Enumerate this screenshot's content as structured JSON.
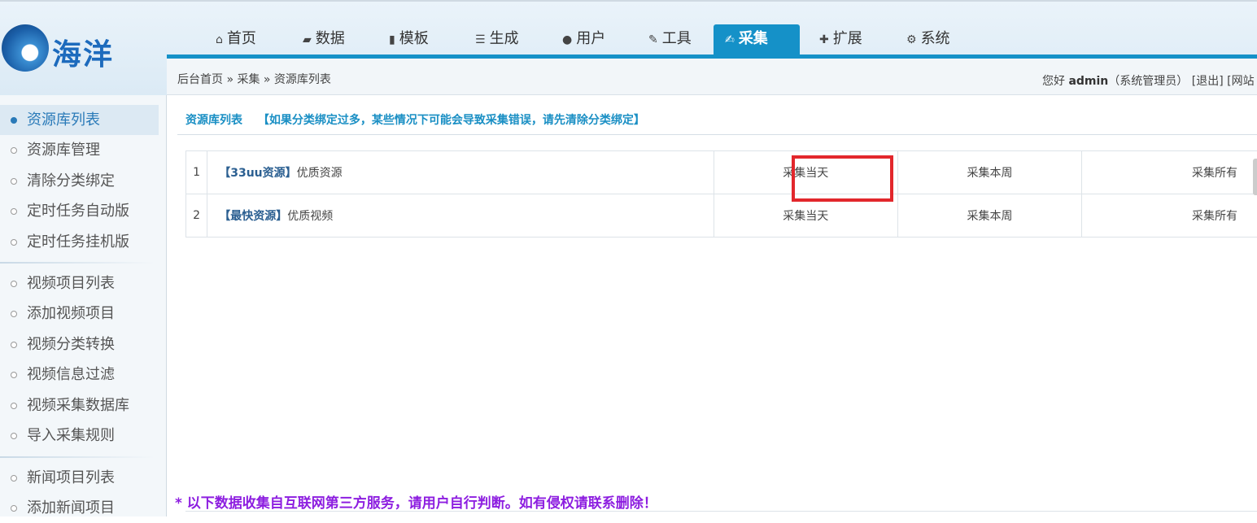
{
  "logo": {
    "text": "海洋"
  },
  "nav": [
    {
      "label": "首页",
      "icon": "home-icon",
      "glyph": "⌂"
    },
    {
      "label": "数据",
      "icon": "book-icon",
      "glyph": "▰"
    },
    {
      "label": "模板",
      "icon": "file-icon",
      "glyph": "▮"
    },
    {
      "label": "生成",
      "icon": "server-icon",
      "glyph": "☰"
    },
    {
      "label": "用户",
      "icon": "user-icon",
      "glyph": "●"
    },
    {
      "label": "工具",
      "icon": "wrench-icon",
      "glyph": "✎"
    },
    {
      "label": "采集",
      "icon": "edit-icon",
      "glyph": "✍",
      "active": true
    },
    {
      "label": "扩展",
      "icon": "puzzle-icon",
      "glyph": "✚"
    },
    {
      "label": "系统",
      "icon": "gear-icon",
      "glyph": "⚙"
    }
  ],
  "breadcrumb": "后台首页 » 采集 » 资源库列表",
  "user": {
    "greeting": "您好",
    "name": "admin",
    "role": "（系统管理员）",
    "logout": "[退出]",
    "site": "[网站"
  },
  "sidebar": [
    {
      "label": "资源库列表",
      "active": true
    },
    {
      "label": "资源库管理"
    },
    {
      "label": "清除分类绑定"
    },
    {
      "label": "定时任务自动版"
    },
    {
      "label": "定时任务挂机版"
    },
    {
      "label": "视频项目列表"
    },
    {
      "label": "添加视频项目"
    },
    {
      "label": "视频分类转换"
    },
    {
      "label": "视频信息过滤"
    },
    {
      "label": "视频采集数据库"
    },
    {
      "label": "导入采集规则"
    },
    {
      "label": "新闻项目列表"
    },
    {
      "label": "添加新闻项目"
    }
  ],
  "content": {
    "title": "资源库列表",
    "warning": "【如果分类绑定过多，某些情况下可能会导致采集错误，请先清除分类绑定】"
  },
  "resources": [
    {
      "num": "1",
      "name": "【33uu资源】",
      "desc": "优质资源",
      "today": "采集当天",
      "week": "采集本周",
      "all": "采集所有"
    },
    {
      "num": "2",
      "name": "【最快资源】",
      "desc": "优质视频",
      "today": "采集当天",
      "week": "采集本周",
      "all": "采集所有"
    }
  ],
  "notice": "* 以下数据收集自互联网第三方服务，请用户自行判断。如有侵权请联系删除！",
  "colors": {
    "accent": "#1591c8",
    "highlight": "#e2272c",
    "notice": "#8d1ee0"
  }
}
